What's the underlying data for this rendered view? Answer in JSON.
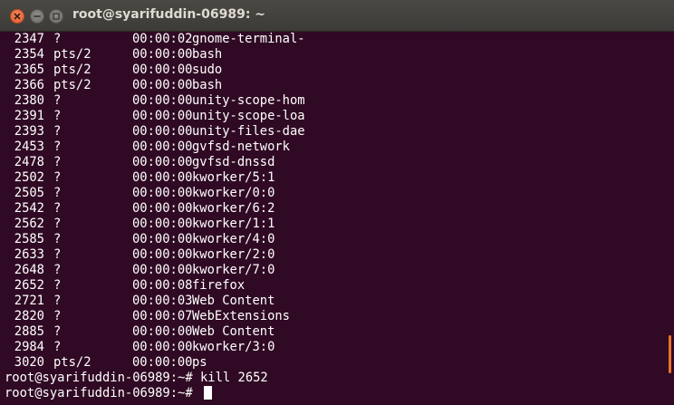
{
  "window": {
    "title": "root@syarifuddin-06989: ~"
  },
  "colors": {
    "terminal_bg": "#300a24",
    "text": "#ffffff",
    "titlebar": "#3c3b37",
    "close_button": "#e05a2b",
    "scroll_indicator": "#e9722c"
  },
  "processes": [
    {
      "pid": "2347",
      "tty": "?",
      "time": "00:00:02",
      "cmd": "gnome-terminal-"
    },
    {
      "pid": "2354",
      "tty": "pts/2",
      "time": "00:00:00",
      "cmd": "bash"
    },
    {
      "pid": "2365",
      "tty": "pts/2",
      "time": "00:00:00",
      "cmd": "sudo"
    },
    {
      "pid": "2366",
      "tty": "pts/2",
      "time": "00:00:00",
      "cmd": "bash"
    },
    {
      "pid": "2380",
      "tty": "?",
      "time": "00:00:00",
      "cmd": "unity-scope-hom"
    },
    {
      "pid": "2391",
      "tty": "?",
      "time": "00:00:00",
      "cmd": "unity-scope-loa"
    },
    {
      "pid": "2393",
      "tty": "?",
      "time": "00:00:00",
      "cmd": "unity-files-dae"
    },
    {
      "pid": "2453",
      "tty": "?",
      "time": "00:00:00",
      "cmd": "gvfsd-network"
    },
    {
      "pid": "2478",
      "tty": "?",
      "time": "00:00:00",
      "cmd": "gvfsd-dnssd"
    },
    {
      "pid": "2502",
      "tty": "?",
      "time": "00:00:00",
      "cmd": "kworker/5:1"
    },
    {
      "pid": "2505",
      "tty": "?",
      "time": "00:00:00",
      "cmd": "kworker/0:0"
    },
    {
      "pid": "2542",
      "tty": "?",
      "time": "00:00:00",
      "cmd": "kworker/6:2"
    },
    {
      "pid": "2562",
      "tty": "?",
      "time": "00:00:00",
      "cmd": "kworker/1:1"
    },
    {
      "pid": "2585",
      "tty": "?",
      "time": "00:00:00",
      "cmd": "kworker/4:0"
    },
    {
      "pid": "2633",
      "tty": "?",
      "time": "00:00:00",
      "cmd": "kworker/2:0"
    },
    {
      "pid": "2648",
      "tty": "?",
      "time": "00:00:00",
      "cmd": "kworker/7:0"
    },
    {
      "pid": "2652",
      "tty": "?",
      "time": "00:00:08",
      "cmd": "firefox"
    },
    {
      "pid": "2721",
      "tty": "?",
      "time": "00:00:03",
      "cmd": "Web Content"
    },
    {
      "pid": "2820",
      "tty": "?",
      "time": "00:00:07",
      "cmd": "WebExtensions"
    },
    {
      "pid": "2885",
      "tty": "?",
      "time": "00:00:00",
      "cmd": "Web Content"
    },
    {
      "pid": "2984",
      "tty": "?",
      "time": "00:00:00",
      "cmd": "kworker/3:0"
    },
    {
      "pid": "3020",
      "tty": "pts/2",
      "time": "00:00:00",
      "cmd": "ps"
    }
  ],
  "prompt_lines": [
    {
      "prompt": "root@syarifuddin-06989:~#",
      "command": " kill 2652"
    },
    {
      "prompt": "root@syarifuddin-06989:~#",
      "command": " "
    }
  ]
}
